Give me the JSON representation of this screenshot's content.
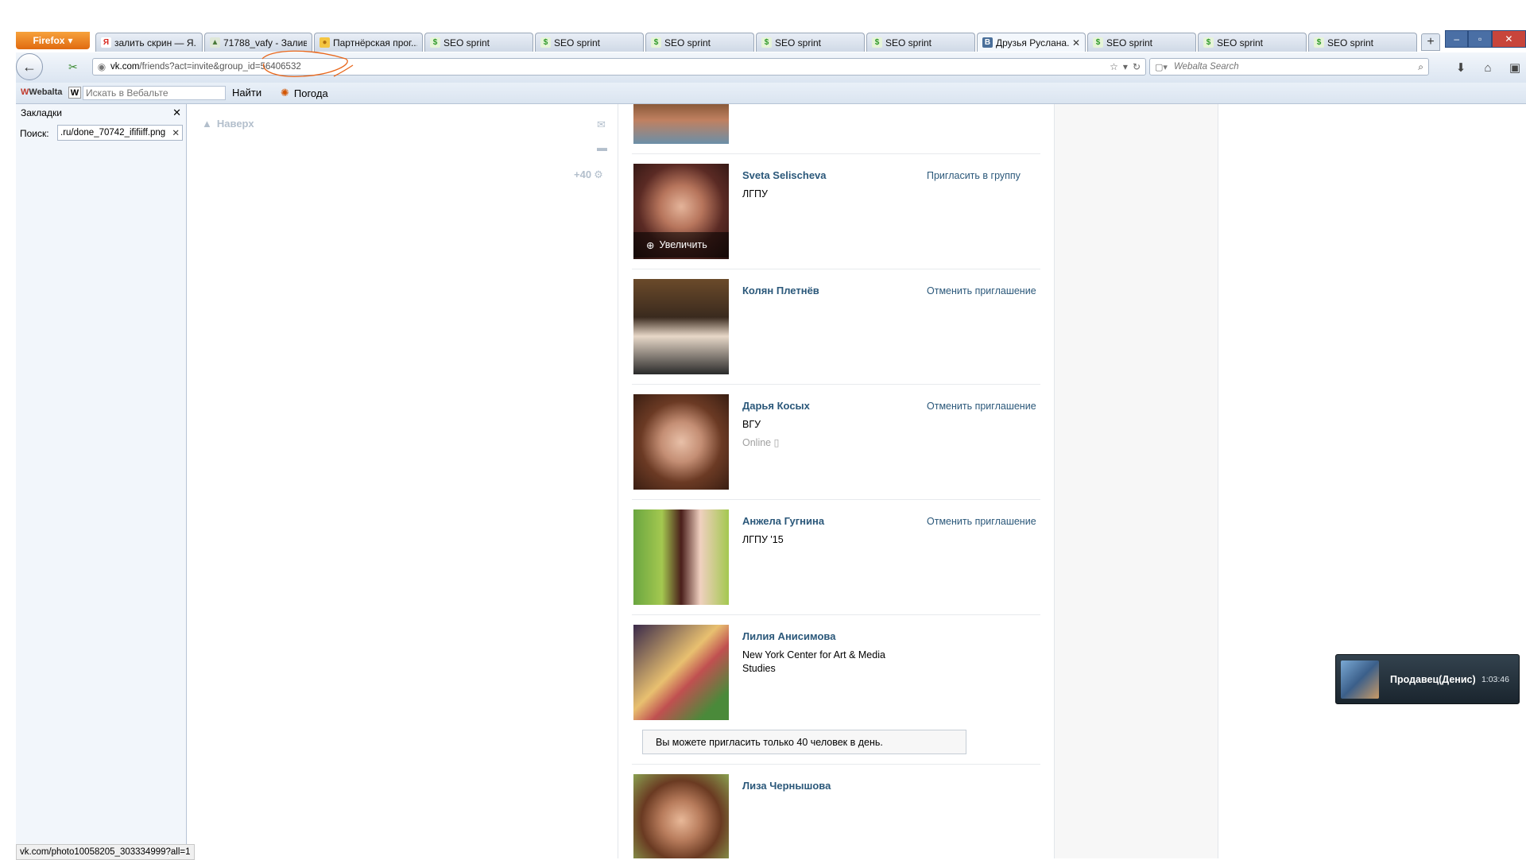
{
  "browser": {
    "app_button": "Firefox",
    "tabs": [
      {
        "label": "залить скрин — Я...",
        "favicon": "yandex-icon"
      },
      {
        "label": "71788_vafy - Залив...",
        "favicon": "image-icon"
      },
      {
        "label": "Партнёрская прог...",
        "favicon": "partner-icon"
      },
      {
        "label": "SEO sprint",
        "favicon": "seosprint-icon"
      },
      {
        "label": "SEO sprint",
        "favicon": "seosprint-icon"
      },
      {
        "label": "SEO sprint",
        "favicon": "seosprint-icon"
      },
      {
        "label": "SEO sprint",
        "favicon": "seosprint-icon"
      },
      {
        "label": "SEO sprint",
        "favicon": "seosprint-icon"
      },
      {
        "label": "Друзья Руслана...",
        "favicon": "vk-icon",
        "active": true
      },
      {
        "label": "SEO sprint",
        "favicon": "seosprint-icon"
      },
      {
        "label": "SEO sprint",
        "favicon": "seosprint-icon"
      },
      {
        "label": "SEO sprint",
        "favicon": "seosprint-icon"
      }
    ],
    "url_domain": "vk.com",
    "url_rest": "/friends?act=invite&group_id=56406532",
    "search_placeholder": "Webalta Search"
  },
  "webalta_toolbar": {
    "logo": "Webalta",
    "input_placeholder": "Искать в Вебальте",
    "find_label": "Найти",
    "weather_label": "Погода"
  },
  "sidebar": {
    "title": "Закладки",
    "search_label": "Поиск:",
    "search_value": ".ru/done_70742_ififiiff.png"
  },
  "vk": {
    "to_top": "Наверх",
    "counter": "+40",
    "zoom_label": "Увеличить",
    "friends": [
      {
        "name": "Sveta Selischeva",
        "sub": "ЛГПУ",
        "action": "Пригласить в группу"
      },
      {
        "name": "Колян Плетнёв",
        "sub": "",
        "action": "Отменить приглашение"
      },
      {
        "name": "Дарья Косых",
        "sub": "ВГУ",
        "online": "Online",
        "action": "Отменить приглашение"
      },
      {
        "name": "Анжела Гугнина",
        "sub": "ЛГПУ '15",
        "action": "Отменить приглашение"
      },
      {
        "name": "Лилия Анисимова",
        "sub": "New York Center for Art & Media Studies",
        "action": ""
      },
      {
        "name": "Лиза Чернышова",
        "sub": "",
        "action": ""
      }
    ],
    "limit_notice": "Вы можете пригласить только 40 человек в день."
  },
  "status_bar": "vk.com/photo10058205_303334999?all=1",
  "chat_popup": {
    "name": "Продавец(Денис)",
    "time": "1:03:46"
  },
  "colors": {
    "vk_link": "#2b587a",
    "firefox_orange": "#e06a10",
    "annotation": "#e8671c"
  }
}
